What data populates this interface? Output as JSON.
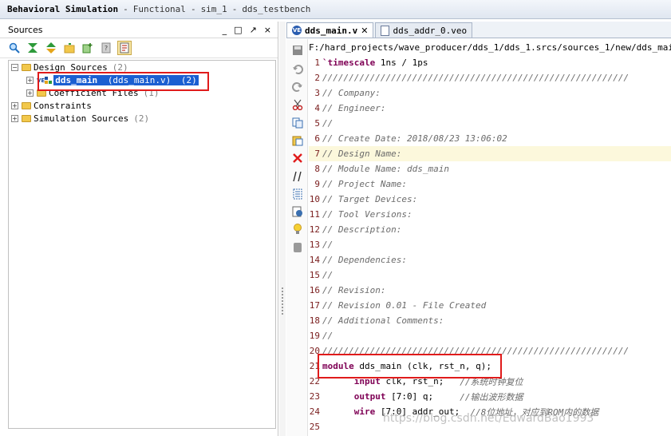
{
  "titlebar": {
    "mode": "Behavioral Simulation",
    "kind": "Functional",
    "sim": "sim_1",
    "top": "dds_testbench"
  },
  "sources": {
    "title": "Sources",
    "controls": [
      "_",
      "□",
      "↗",
      "×"
    ],
    "tree": {
      "design_sources": {
        "label": "Design Sources",
        "count": "(2)"
      },
      "dds_main": {
        "badge": "VE",
        "label": "dds_main",
        "file": "(dds_main.v)",
        "count": "(2)"
      },
      "coefficient_files": {
        "label": "Coefficient Files",
        "count": "(1)"
      },
      "constraints": {
        "label": "Constraints"
      },
      "simulation_sources": {
        "label": "Simulation Sources",
        "count": "(2)"
      }
    }
  },
  "editor": {
    "tabs": [
      {
        "label": "dds_main.v",
        "icon": "verilog-file-icon",
        "active": true
      },
      {
        "label": "dds_addr_0.veo",
        "icon": "document-icon",
        "active": false
      }
    ],
    "path": "F:/hard_projects/wave_producer/dds_1/dds_1.srcs/sources_1/new/dds_main.v",
    "lines": [
      {
        "n": "1",
        "parts": [
          {
            "t": "`timescale",
            "c": "kw"
          },
          {
            "t": " 1ns / 1ps",
            "c": "plain"
          }
        ]
      },
      {
        "n": "2",
        "parts": [
          {
            "t": "//////////////////////////////////////////////////////////",
            "c": "comment"
          }
        ]
      },
      {
        "n": "3",
        "parts": [
          {
            "t": "// Company:",
            "c": "comment"
          }
        ]
      },
      {
        "n": "4",
        "parts": [
          {
            "t": "// Engineer:",
            "c": "comment"
          }
        ]
      },
      {
        "n": "5",
        "parts": [
          {
            "t": "//",
            "c": "comment"
          }
        ]
      },
      {
        "n": "6",
        "parts": [
          {
            "t": "// Create Date: 2018/08/23 13:06:02",
            "c": "comment"
          }
        ]
      },
      {
        "n": "7",
        "parts": [
          {
            "t": "// Design Name:",
            "c": "comment"
          }
        ],
        "hl": true
      },
      {
        "n": "8",
        "parts": [
          {
            "t": "// Module Name: dds_main",
            "c": "comment"
          }
        ]
      },
      {
        "n": "9",
        "parts": [
          {
            "t": "// Project Name:",
            "c": "comment"
          }
        ]
      },
      {
        "n": "10",
        "parts": [
          {
            "t": "// Target Devices:",
            "c": "comment"
          }
        ]
      },
      {
        "n": "11",
        "parts": [
          {
            "t": "// Tool Versions:",
            "c": "comment"
          }
        ]
      },
      {
        "n": "12",
        "parts": [
          {
            "t": "// Description:",
            "c": "comment"
          }
        ]
      },
      {
        "n": "13",
        "parts": [
          {
            "t": "//",
            "c": "comment"
          }
        ]
      },
      {
        "n": "14",
        "parts": [
          {
            "t": "// Dependencies:",
            "c": "comment"
          }
        ]
      },
      {
        "n": "15",
        "parts": [
          {
            "t": "//",
            "c": "comment"
          }
        ]
      },
      {
        "n": "16",
        "parts": [
          {
            "t": "// Revision:",
            "c": "comment"
          }
        ]
      },
      {
        "n": "17",
        "parts": [
          {
            "t": "// Revision 0.01 - File Created",
            "c": "comment"
          }
        ]
      },
      {
        "n": "18",
        "parts": [
          {
            "t": "// Additional Comments:",
            "c": "comment"
          }
        ]
      },
      {
        "n": "19",
        "parts": [
          {
            "t": "//",
            "c": "comment"
          }
        ]
      },
      {
        "n": "20",
        "parts": [
          {
            "t": "//////////////////////////////////////////////////////////",
            "c": "comment"
          }
        ]
      },
      {
        "n": "21",
        "parts": [
          {
            "t": "module",
            "c": "kw"
          },
          {
            "t": " dds_main (clk, rst_n, q);",
            "c": "plain"
          }
        ]
      },
      {
        "n": "22",
        "parts": [
          {
            "t": "      ",
            "c": "plain"
          },
          {
            "t": "input",
            "c": "kw"
          },
          {
            "t": " clk, rst_n;   ",
            "c": "plain"
          },
          {
            "t": "//系统时钟复位",
            "c": "comment"
          }
        ]
      },
      {
        "n": "23",
        "parts": [
          {
            "t": "      ",
            "c": "plain"
          },
          {
            "t": "output",
            "c": "kw"
          },
          {
            "t": " [7:0] q;     ",
            "c": "plain"
          },
          {
            "t": "//输出波形数据",
            "c": "comment"
          }
        ]
      },
      {
        "n": "24",
        "parts": [
          {
            "t": "      ",
            "c": "plain"
          },
          {
            "t": "wire",
            "c": "kw"
          },
          {
            "t": " [7:0] addr_out;  ",
            "c": "plain"
          },
          {
            "t": "//8位地址，对应到ROM内的数据",
            "c": "comment"
          }
        ]
      },
      {
        "n": "25",
        "parts": []
      }
    ]
  },
  "watermark": "https://blog.csdn.net/EdwardBao1993"
}
